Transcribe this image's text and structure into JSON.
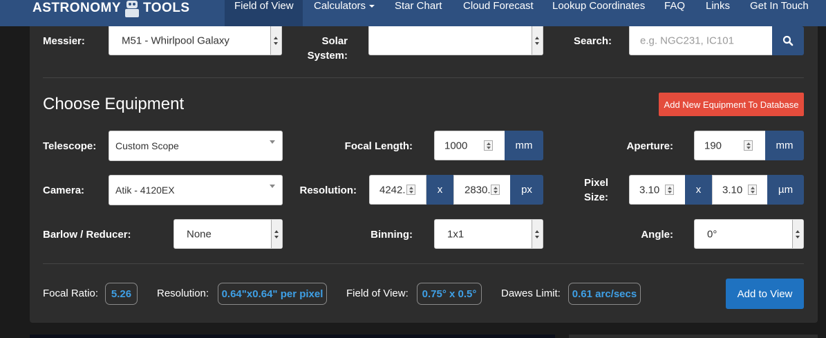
{
  "nav": {
    "brand_left": "ASTRONOMY",
    "brand_right": "TOOLS",
    "items": [
      {
        "label": "Field of View"
      },
      {
        "label": "Calculators"
      },
      {
        "label": "Star Chart"
      },
      {
        "label": "Cloud Forecast"
      },
      {
        "label": "Lookup Coordinates"
      },
      {
        "label": "FAQ"
      },
      {
        "label": "Links"
      },
      {
        "label": "Get In Touch"
      }
    ]
  },
  "target": {
    "messier_label": "Messier:",
    "messier_value": "M51 - Whirlpool Galaxy",
    "solar_label_line1": "Solar",
    "solar_label_line2": "System:",
    "solar_value": "",
    "search_label": "Search:",
    "search_placeholder": "e.g. NGC231, IC101"
  },
  "equipment": {
    "title": "Choose Equipment",
    "add_equipment_button": "Add New Equipment To Database",
    "telescope_label": "Telescope:",
    "telescope_value": "Custom Scope",
    "focal_length_label": "Focal Length:",
    "focal_length_value": "1000",
    "focal_length_unit": "mm",
    "aperture_label": "Aperture:",
    "aperture_value": "190",
    "aperture_unit": "mm",
    "camera_label": "Camera:",
    "camera_value": "Atik - 4120EX",
    "resolution_label": "Resolution:",
    "resolution_x": "4242.",
    "resolution_sep": "x",
    "resolution_y": "2830.",
    "resolution_unit": "px",
    "pixel_size_label_line1": "Pixel",
    "pixel_size_label_line2": "Size:",
    "pixel_x": "3.10",
    "pixel_sep": "x",
    "pixel_y": "3.10",
    "pixel_unit": "µm",
    "barlow_label": "Barlow / Reducer:",
    "barlow_value": "None",
    "binning_label": "Binning:",
    "binning_value": "1x1",
    "angle_label": "Angle:",
    "angle_value": "0°"
  },
  "results": {
    "focal_ratio_label": "Focal Ratio:",
    "focal_ratio_value": "5.26",
    "resolution_label": "Resolution:",
    "resolution_value": "0.64\"x0.64\" per pixel",
    "fov_label": "Field of View:",
    "fov_value": "0.75° x 0.5°",
    "dawes_label": "Dawes Limit:",
    "dawes_value": "0.61 arc/secs",
    "add_to_view_button": "Add to View"
  },
  "colors": {
    "navbar": "#2e5080",
    "panel": "#2d2d2d",
    "badge_text": "#3fa0e6",
    "red_button": "#e44c3c",
    "blue_button": "#1f72c0"
  }
}
